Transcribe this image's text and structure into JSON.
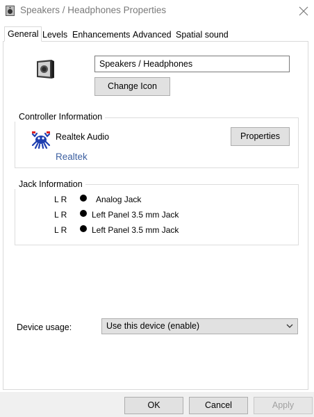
{
  "window": {
    "title": "Speakers / Headphones Properties",
    "close_icon": "close-icon",
    "title_icon": "speaker-icon"
  },
  "tabs": [
    {
      "label": "General",
      "active": true
    },
    {
      "label": "Levels",
      "active": false
    },
    {
      "label": "Enhancements",
      "active": false
    },
    {
      "label": "Advanced",
      "active": false
    },
    {
      "label": "Spatial sound",
      "active": false
    }
  ],
  "device": {
    "icon": "speaker-device-icon",
    "name_value": "Speakers / Headphones",
    "change_icon_label": "Change Icon"
  },
  "controller": {
    "group_title": "Controller Information",
    "logo": "realtek-crab-logo",
    "name": "Realtek Audio",
    "vendor_link": "Realtek",
    "properties_label": "Properties"
  },
  "jack": {
    "group_title": "Jack Information",
    "rows": [
      {
        "channels": "L R",
        "name": "Analog Jack"
      },
      {
        "channels": "L R",
        "name": "Left Panel 3.5 mm Jack"
      },
      {
        "channels": "L R",
        "name": "Left Panel 3.5 mm Jack"
      }
    ]
  },
  "usage": {
    "label": "Device usage:",
    "selected": "Use this device (enable)",
    "chevron": "chevron-down-icon"
  },
  "footer": {
    "ok_label": "OK",
    "cancel_label": "Cancel",
    "apply_label": "Apply",
    "apply_enabled": false
  },
  "colors": {
    "link": "#3c5fa0",
    "button_face": "#e1e1e1",
    "border": "#adadad",
    "footer_bg": "#f0f0f0"
  }
}
